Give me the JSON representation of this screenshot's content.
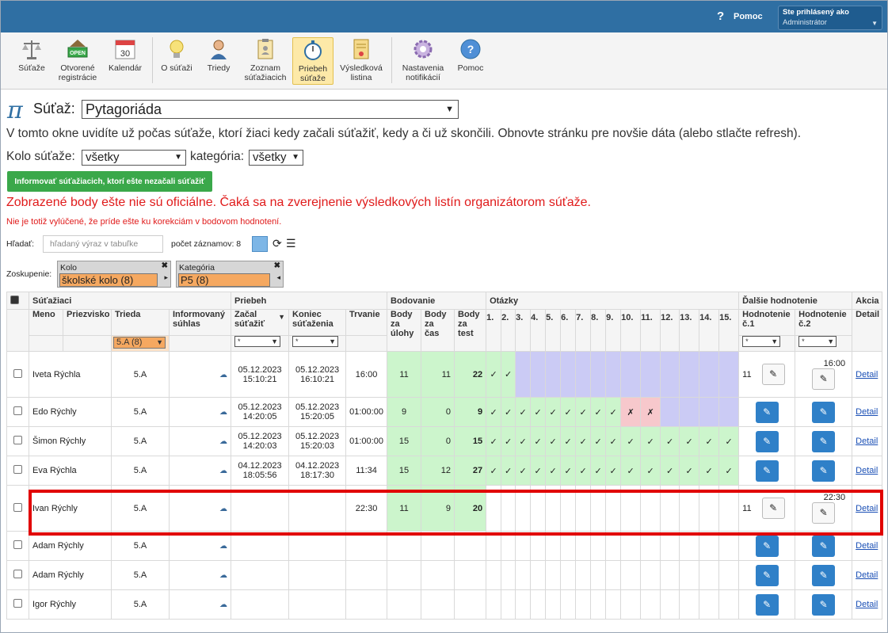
{
  "header": {
    "help_label": "Pomoc",
    "user_line1": "Ste prihlásený ako",
    "user_line2": "Administrátor"
  },
  "toolbar": [
    {
      "label1": "Súťaže",
      "label2": "",
      "icon": "scales-icon"
    },
    {
      "label1": "Otvorené",
      "label2": "registrácie",
      "icon": "open-sign-icon"
    },
    {
      "label1": "Kalendár",
      "label2": "",
      "icon": "calendar-icon",
      "day": "30"
    },
    {
      "label1": "O súťaži",
      "label2": "",
      "icon": "lightbulb-icon"
    },
    {
      "label1": "Triedy",
      "label2": "",
      "icon": "person-icon"
    },
    {
      "label1": "Zoznam",
      "label2": "súťažiacich",
      "icon": "clipboard-icon"
    },
    {
      "label1": "Priebeh",
      "label2": "súťaže",
      "icon": "stopwatch-icon"
    },
    {
      "label1": "Výsledková",
      "label2": "listina",
      "icon": "certificate-icon"
    },
    {
      "label1": "Nastavenia",
      "label2": "notifikácií",
      "icon": "gear-icon"
    },
    {
      "label1": "Pomoc",
      "label2": "",
      "icon": "help-icon"
    }
  ],
  "title": {
    "pi": "π",
    "label": "Súťaž:",
    "selected": "Pytagoriáda"
  },
  "info_text": "V tomto okne uvidíte už počas súťaže, ktorí žiaci kedy začali súťažiť, kedy a či už skončili. Obnovte stránku pre novšie dáta (alebo stlačte refresh).",
  "filters": {
    "kolo_label": "Kolo súťaže:",
    "kolo_value": "všetky",
    "kategoria_label": "kategória:",
    "kategoria_value": "všetky"
  },
  "notify_button": "Informovať súťažiacich, ktorí ešte nezačali súťažiť",
  "warning_main": "Zobrazené body ešte nie sú oficiálne. Čaká sa na zverejnenie výsledkových listín organizátorom súťaže.",
  "warning_sub": "Nie je totiž vylúčené, že príde ešte ku korekciám v bodovom hodnotení.",
  "search": {
    "label": "Hľadať:",
    "placeholder": "hľadaný výraz v tabuľke"
  },
  "record_count": "počet záznamov: 8",
  "grouping": {
    "label": "Zoskupenie:",
    "kolo_title": "Kolo",
    "kolo_value": "školské kolo (8)",
    "kategoria_title": "Kategória",
    "kategoria_value": "P5 (8)"
  },
  "table": {
    "groups": {
      "sutaziaci": "Súťažiaci",
      "priebeh": "Priebeh",
      "bodovanie": "Bodovanie",
      "otazky": "Otázky",
      "dalsie": "Ďalšie hodnotenie",
      "akcia": "Akcia"
    },
    "headers": {
      "meno": "Meno",
      "priezvisko": "Priezvisko",
      "trieda": "Trieda",
      "suhlas1": "Informovaný",
      "suhlas2": "súhlas",
      "zacal1": "Začal",
      "zacal2": "súťažiť",
      "koniec1": "Koniec",
      "koniec2": "súťaženia",
      "trvanie": "Trvanie",
      "bu1": "Body",
      "bu2": "za",
      "bu3": "úlohy",
      "bc1": "Body",
      "bc2": "za",
      "bc3": "čas",
      "bt1": "Body",
      "bt2": "za",
      "bt3": "test",
      "q": [
        "1.",
        "2.",
        "3.",
        "4.",
        "5.",
        "6.",
        "7.",
        "8.",
        "9.",
        "10.",
        "11.",
        "12.",
        "13.",
        "14.",
        "15."
      ],
      "h1a": "Hodnotenie",
      "h1b": "č.1",
      "h2a": "Hodnotenie",
      "h2b": "č.2",
      "detail": "Detail"
    },
    "filter_all": "*",
    "trieda_filter": "5.A (8)",
    "rows": [
      {
        "name": "Iveta Rýchla",
        "class": "5.A",
        "start": "05.12.2023 15:10:21",
        "end": "05.12.2023 16:10:21",
        "duration": "16:00",
        "bu": "11",
        "bc": "11",
        "bt": "22",
        "q": [
          "g✓",
          "g✓",
          "p",
          "p",
          "p",
          "p",
          "p",
          "p",
          "p",
          "p",
          "p",
          "p",
          "p",
          "p",
          "p"
        ],
        "h1": "11",
        "h1btn": "white",
        "h2": "16:00",
        "h2btn": "white",
        "detail": "Detail"
      },
      {
        "name": "Edo Rýchly",
        "class": "5.A",
        "start": "05.12.2023 14:20:05",
        "end": "05.12.2023 15:20:05",
        "duration": "01:00:00",
        "bu": "9",
        "bc": "0",
        "bt": "9",
        "q": [
          "g✓",
          "g✓",
          "g✓",
          "g✓",
          "g✓",
          "g✓",
          "g✓",
          "g✓",
          "g✓",
          "r✗",
          "r✗",
          "p",
          "p",
          "p",
          "p"
        ],
        "h1": "",
        "h1btn": "blue",
        "h2": "",
        "h2btn": "blue",
        "detail": "Detail"
      },
      {
        "name": "Šimon Rýchly",
        "class": "5.A",
        "start": "05.12.2023 14:20:03",
        "end": "05.12.2023 15:20:03",
        "duration": "01:00:00",
        "bu": "15",
        "bc": "0",
        "bt": "15",
        "q": [
          "g✓",
          "g✓",
          "g✓",
          "g✓",
          "g✓",
          "g✓",
          "g✓",
          "g✓",
          "g✓",
          "g✓",
          "g✓",
          "g✓",
          "g✓",
          "g✓",
          "g✓"
        ],
        "h1": "",
        "h1btn": "blue",
        "h2": "",
        "h2btn": "blue",
        "detail": "Detail"
      },
      {
        "name": "Eva Rýchla",
        "class": "5.A",
        "start": "04.12.2023 18:05:56",
        "end": "04.12.2023 18:17:30",
        "duration": "11:34",
        "bu": "15",
        "bc": "12",
        "bt": "27",
        "q": [
          "g✓",
          "g✓",
          "g✓",
          "g✓",
          "g✓",
          "g✓",
          "g✓",
          "g✓",
          "g✓",
          "g✓",
          "g✓",
          "g✓",
          "g✓",
          "g✓",
          "g✓"
        ],
        "h1": "",
        "h1btn": "blue",
        "h2": "",
        "h2btn": "blue",
        "detail": "Detail"
      },
      {
        "name": "Ivan Rýchly",
        "class": "5.A",
        "start": "",
        "end": "",
        "duration": "22:30",
        "bu": "11",
        "bc": "9",
        "bt": "20",
        "q": [
          "",
          "",
          "",
          "",
          "",
          "",
          "",
          "",
          "",
          "",
          "",
          "",
          "",
          "",
          ""
        ],
        "h1": "11",
        "h1btn": "white",
        "h2": "22:30",
        "h2btn": "white",
        "detail": "Detail"
      },
      {
        "name": "Adam Rýchly",
        "class": "5.A",
        "start": "",
        "end": "",
        "duration": "",
        "bu": "",
        "bc": "",
        "bt": "",
        "q": [
          "",
          "",
          "",
          "",
          "",
          "",
          "",
          "",
          "",
          "",
          "",
          "",
          "",
          "",
          ""
        ],
        "h1": "",
        "h1btn": "blue",
        "h2": "",
        "h2btn": "blue",
        "detail": "Detail"
      },
      {
        "name": "Adam Rýchly",
        "class": "5.A",
        "start": "",
        "end": "",
        "duration": "",
        "bu": "",
        "bc": "",
        "bt": "",
        "q": [
          "",
          "",
          "",
          "",
          "",
          "",
          "",
          "",
          "",
          "",
          "",
          "",
          "",
          "",
          ""
        ],
        "h1": "",
        "h1btn": "blue",
        "h2": "",
        "h2btn": "blue",
        "detail": "Detail"
      },
      {
        "name": "Igor Rýchly",
        "class": "5.A",
        "start": "",
        "end": "",
        "duration": "",
        "bu": "",
        "bc": "",
        "bt": "",
        "q": [
          "",
          "",
          "",
          "",
          "",
          "",
          "",
          "",
          "",
          "",
          "",
          "",
          "",
          "",
          ""
        ],
        "h1": "",
        "h1btn": "blue",
        "h2": "",
        "h2btn": "blue",
        "detail": "Detail"
      }
    ]
  },
  "colors": {
    "topbar": "#2f6fa3",
    "green_cell": "#ccf5cc",
    "purple_cell": "#cbcbf5",
    "red_cell": "#f7c8cc",
    "highlight": "#e10000",
    "action_blue": "#2f80c8"
  }
}
